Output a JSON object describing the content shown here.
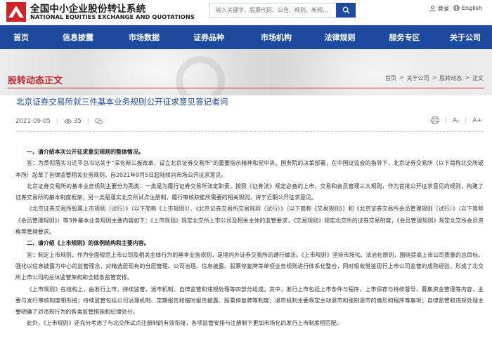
{
  "header": {
    "brand_cn": "全国中小企业股份转让系统",
    "brand_en": "NATIONAL EQUITIES EXCHANGE AND QUOTATIONS",
    "search_placeholder": "输入关键字、股票代码、公告、规则、新闻…",
    "login_label": "登录",
    "language_label": "English",
    "colors": {
      "logo_red": "#d2222a",
      "nav_blue": "#1b4aa0",
      "accent_red": "#c0282e",
      "link_blue": "#1d4aa2"
    }
  },
  "nav": {
    "items": [
      {
        "label": "首页"
      },
      {
        "label": "信息披露"
      },
      {
        "label": "市场数据"
      },
      {
        "label": "证券品种"
      },
      {
        "label": "市场机构"
      },
      {
        "label": "法律规则"
      },
      {
        "label": "服务专区"
      },
      {
        "label": "关于公司"
      }
    ]
  },
  "section": {
    "title": "股转动态正文",
    "breadcrumb": [
      "首页",
      ">",
      "关于公司",
      ">",
      "股转动态",
      ">",
      "正文"
    ]
  },
  "article": {
    "title": "北京证券交易所就三件基本业务规则公开征求意见答记者问",
    "date": "2021-09-05",
    "views": "35",
    "font_small": "A-",
    "font_large": "A+",
    "paragraphs": [
      {
        "text": "一、请介绍本次公开征求意见规则的整体情况。",
        "heading": true
      },
      {
        "text": "答：为贯彻落实习近平总书记关于“深化新三板改革，设立北京证券交易所”的重要指示精神和党中央、国务院的决策部署，在中国证监会的指导下，北京证券交易所（以下简称北交所或本所）起草了自律监管相关业务规则，自2021年9月5日起陆续向市场公开征求意见。",
        "heading": false
      },
      {
        "text": "北京证券交易所的基本业务规则主要分为两类：一类是为履行证券交易所法定职责，按照《证券法》规定必备的上市、交易和会员管理三大规则，作为首批公开征求意见的规则，构建了证券交易所的基本制度框架；另一类是落实北交所试点注册制，履行审核职能所需要的相关规则，将于近期公开征求意见。",
        "heading": false
      },
      {
        "text": "《北京证券交易所股票上市规则（试行）》（以下简称《上市规则》）、《北京证券交易所交易规则（试行）》（以下简称《交易规则》）和《北京证券交易所会员管理规则（试行）》（以下简称《会员管理规则》）等3件基本业务规则主要内容如下：《上市规则》规定北交所上市公司及相关主体的监管要求，《交易规则》规定北交所的证券交易制度，《会员管理规则》规定北交所会员资格等管理要求。",
        "heading": false
      },
      {
        "text": "二、请介绍《上市规则》的体例结构和主要内容。",
        "heading": true
      },
      {
        "text": "答：制定上市规则，作为全面规范上市公司及相关主体行为的基本业务规则，是境内外证券交易所的通行做法。《上市规则》坚持市场化、法治化原则，围绕提高上市公司质量的总目标，强化以信息披露为中心的监管理念，对精选层现有的分层管理、公司治理、信息披露、股票停复牌等单项业务规则进行体系化整合，同时吸收借鉴现行上市公司监管的成熟经验，形成了北交所上市公司的总体监管架构和全链条监管安排。",
        "heading": false
      },
      {
        "text": "《上市规则》在结构上，由发行上市、持续监管、退市机制、自律监管和违规处理等四部分组成。其中，发行上市包括上市条件与程序、上市保荐与持续督导、募集资金管理等内容，主要与发行审核制度相衔接；持续监管包括公司治理机制、定期报告和临时报告披露、股票停复牌等制度；退市机制主要规定主动退市和强制退市的情形和程序等事项；自律监管和违规处理主要明确了对违规行为的各类监管措施和纪律处分。",
        "heading": false
      },
      {
        "text": "此外，《上市规则》还充分考虑了与北交所试点注册制的有效衔接，各项监管安排与注册制下更加市场化的发行上市制度相匹配。",
        "heading": false
      }
    ]
  }
}
